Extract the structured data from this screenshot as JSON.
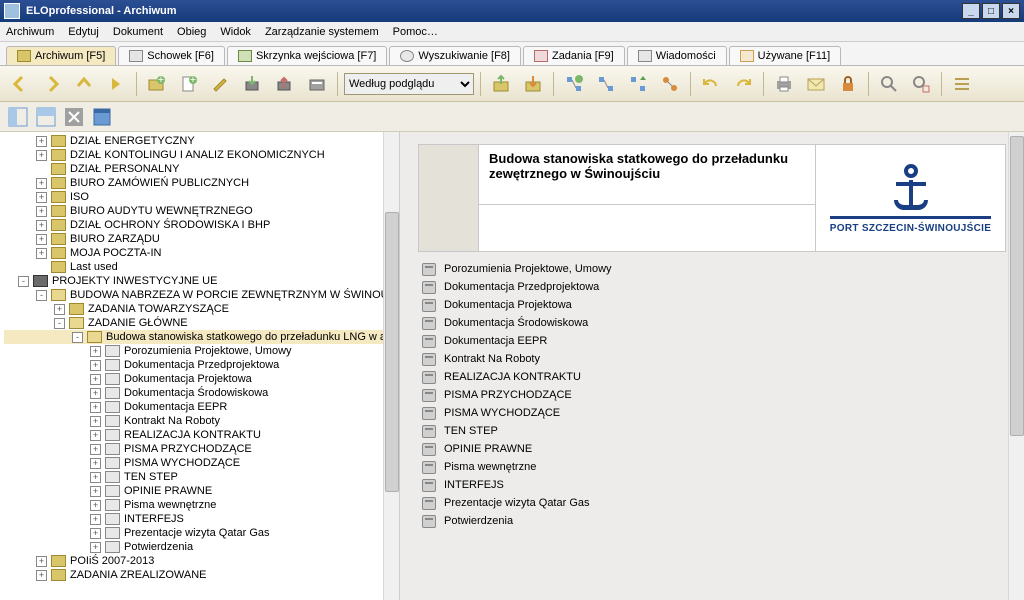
{
  "app": {
    "title": "ELOprofessional  -  Archiwum"
  },
  "menu": [
    "Archiwum",
    "Edytuj",
    "Dokument",
    "Obieg",
    "Widok",
    "Zarządzanie systemem",
    "Pomoc…"
  ],
  "tabs": [
    {
      "label": "Archiwum [F5]",
      "active": true,
      "icon": "i-archive"
    },
    {
      "label": "Schowek [F6]",
      "icon": "i-clip"
    },
    {
      "label": "Skrzynka wejściowa [F7]",
      "icon": "i-inbox"
    },
    {
      "label": "Wyszukiwanie [F8]",
      "icon": "i-search"
    },
    {
      "label": "Zadania [F9]",
      "icon": "i-tasks"
    },
    {
      "label": "Wiadomości",
      "icon": "i-msg"
    },
    {
      "label": "Używane [F11]",
      "icon": "i-pencil"
    }
  ],
  "toolbar": {
    "view_select": "Według podglądu"
  },
  "tree": [
    {
      "l": 1,
      "exp": "+",
      "icon": "ni-folder",
      "label": "DZIAŁ ENERGETYCZNY"
    },
    {
      "l": 1,
      "exp": "+",
      "icon": "ni-folder",
      "label": "DZIAŁ KONTOLINGU I ANALIZ EKONOMICZNYCH"
    },
    {
      "l": 1,
      "exp": "",
      "icon": "ni-folder",
      "label": "DZIAŁ PERSONALNY"
    },
    {
      "l": 1,
      "exp": "+",
      "icon": "ni-folder",
      "label": "BIURO ZAMÓWIEŃ PUBLICZNYCH"
    },
    {
      "l": 1,
      "exp": "+",
      "icon": "ni-folder",
      "label": "ISO"
    },
    {
      "l": 1,
      "exp": "+",
      "icon": "ni-folder",
      "label": "BIURO AUDYTU WEWNĘTRZNEGO"
    },
    {
      "l": 1,
      "exp": "+",
      "icon": "ni-folder",
      "label": "DZIAŁ OCHRONY ŚRODOWISKA I BHP"
    },
    {
      "l": 1,
      "exp": "+",
      "icon": "ni-folder",
      "label": "BIURO ZARZĄDU"
    },
    {
      "l": 1,
      "exp": "+",
      "icon": "ni-folder",
      "label": "MOJA POCZTA-IN"
    },
    {
      "l": 1,
      "exp": "",
      "icon": "ni-folder",
      "label": "Last used"
    },
    {
      "l": 0,
      "exp": "-",
      "icon": "ni-proj",
      "label": "PROJEKTY INWESTYCYJNE UE"
    },
    {
      "l": 1,
      "exp": "-",
      "icon": "ni-folder-o",
      "label": "BUDOWA NABRZEZA W PORCIE ZEWNĘTRZNYM W ŚWINOUJ"
    },
    {
      "l": 2,
      "exp": "+",
      "icon": "ni-folder",
      "label": "ZADANIA TOWARZYSZĄCE"
    },
    {
      "l": 2,
      "exp": "-",
      "icon": "ni-folder-o",
      "label": "ZADANIE GŁÓWNE"
    },
    {
      "l": 3,
      "exp": "-",
      "icon": "ni-folder-o",
      "label": "Budowa stanowiska statkowego do przeładunku LNG w aku",
      "sel": true
    },
    {
      "l": 4,
      "exp": "+",
      "icon": "ni-doc",
      "label": "Porozumienia Projektowe, Umowy"
    },
    {
      "l": 4,
      "exp": "+",
      "icon": "ni-doc",
      "label": "Dokumentacja Przedprojektowa"
    },
    {
      "l": 4,
      "exp": "+",
      "icon": "ni-doc",
      "label": "Dokumentacja Projektowa"
    },
    {
      "l": 4,
      "exp": "+",
      "icon": "ni-doc",
      "label": "Dokumentacja Środowiskowa"
    },
    {
      "l": 4,
      "exp": "+",
      "icon": "ni-doc",
      "label": "Dokumentacja EEPR"
    },
    {
      "l": 4,
      "exp": "+",
      "icon": "ni-doc",
      "label": "Kontrakt Na Roboty"
    },
    {
      "l": 4,
      "exp": "+",
      "icon": "ni-doc",
      "label": "REALIZACJA KONTRAKTU"
    },
    {
      "l": 4,
      "exp": "+",
      "icon": "ni-doc",
      "label": "PISMA PRZYCHODZĄCE"
    },
    {
      "l": 4,
      "exp": "+",
      "icon": "ni-doc",
      "label": "PISMA WYCHODZĄCE"
    },
    {
      "l": 4,
      "exp": "+",
      "icon": "ni-doc",
      "label": "TEN STEP"
    },
    {
      "l": 4,
      "exp": "+",
      "icon": "ni-doc",
      "label": "OPINIE PRAWNE"
    },
    {
      "l": 4,
      "exp": "+",
      "icon": "ni-doc",
      "label": "Pisma wewnętrzne"
    },
    {
      "l": 4,
      "exp": "+",
      "icon": "ni-doc",
      "label": "INTERFEJS"
    },
    {
      "l": 4,
      "exp": "+",
      "icon": "ni-doc",
      "label": "Prezentacje  wizyta Qatar Gas"
    },
    {
      "l": 4,
      "exp": "+",
      "icon": "ni-doc",
      "label": "Potwierdzenia"
    },
    {
      "l": 1,
      "exp": "+",
      "icon": "ni-folder",
      "label": "POIiŚ 2007-2013"
    },
    {
      "l": 1,
      "exp": "+",
      "icon": "ni-folder",
      "label": "ZADANIA ZREALIZOWANE"
    }
  ],
  "detail": {
    "title": "Budowa stanowiska statkowego do przeładunku zewętrznego w Świnoujściu",
    "logo_text": "PORT SZCZECIN-ŚWINOUJŚCIE",
    "items": [
      "Porozumienia Projektowe, Umowy",
      "Dokumentacja Przedprojektowa",
      "Dokumentacja Projektowa",
      "Dokumentacja Środowiskowa",
      "Dokumentacja EEPR",
      "Kontrakt Na Roboty",
      "REALIZACJA KONTRAKTU",
      "PISMA PRZYCHODZĄCE",
      "PISMA WYCHODZĄCE",
      "TEN STEP",
      "OPINIE PRAWNE",
      "Pisma wewnętrzne",
      "INTERFEJS",
      "Prezentacje  wizyta Qatar Gas",
      "Potwierdzenia"
    ]
  }
}
